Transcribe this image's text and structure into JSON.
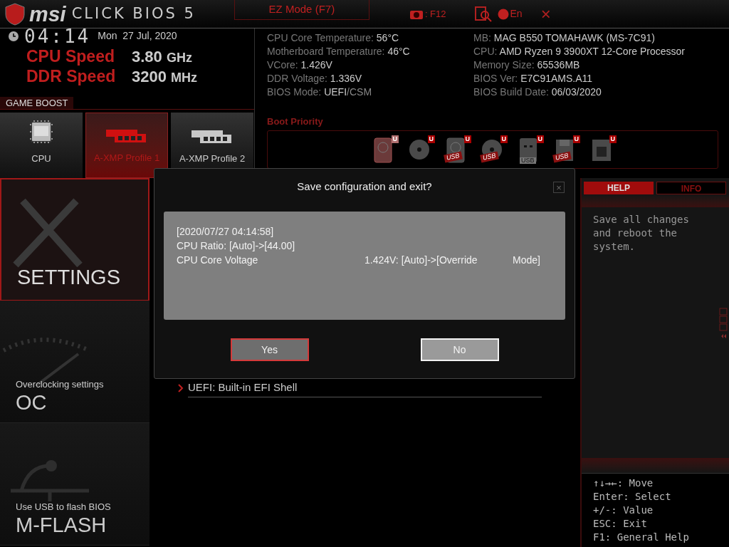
{
  "header": {
    "brand": "msi",
    "product": "CLICK BIOS 5",
    "ez_mode": "EZ Mode (F7)",
    "screenshot_key": ": F12",
    "language": "En",
    "close": "×"
  },
  "clock": {
    "time": "04:14",
    "date": "Mon  27 Jul, 2020"
  },
  "speeds": [
    {
      "label": "CPU Speed",
      "value": "3.80",
      "unit": "GHz"
    },
    {
      "label": "DDR Speed",
      "value": "3200",
      "unit": "MHz"
    }
  ],
  "game_boost": {
    "title": "GAME BOOST",
    "tiles": [
      {
        "kind": "cpu",
        "label": "CPU",
        "selected": false
      },
      {
        "kind": "ram",
        "label": "A-XMP Profile 1",
        "selected": true
      },
      {
        "kind": "ram2",
        "label": "A-XMP Profile 2",
        "selected": false
      }
    ]
  },
  "system_info": {
    "left": [
      {
        "label": "CPU Core Temperature:",
        "value": "56°C"
      },
      {
        "label": "Motherboard Temperature:",
        "value": "46°C"
      },
      {
        "label": "VCore:",
        "value": "1.426V"
      },
      {
        "label": "DDR Voltage:",
        "value": "1.336V"
      },
      {
        "label": "BIOS Mode:",
        "value": "UEFI",
        "value_2": "/CSM"
      }
    ],
    "right": [
      {
        "label": "MB:",
        "value": "MAG B550 TOMAHAWK (MS-7C91)"
      },
      {
        "label": "CPU:",
        "value": "AMD Ryzen 9 3900XT 12-Core Processor"
      },
      {
        "label": "Memory Size:",
        "value": "65536MB"
      },
      {
        "label": "BIOS Ver:",
        "value": "E7C91AMS.A11"
      },
      {
        "label": "BIOS Build Date:",
        "value": "06/03/2020"
      }
    ]
  },
  "boot_priority": {
    "title": "Boot Priority",
    "devices": [
      {
        "kind": "hdd",
        "badge": "U",
        "selected": true
      },
      {
        "kind": "optical",
        "badge": "U",
        "selected": false
      },
      {
        "kind": "usb-hdd",
        "badge": "U",
        "usb_label": "USB",
        "selected": false
      },
      {
        "kind": "usb-optical",
        "badge": "U",
        "usb_label": "USB",
        "selected": false
      },
      {
        "kind": "usb-key",
        "badge": "U",
        "usb_label": "USB",
        "selected": false
      },
      {
        "kind": "usb-floppy",
        "badge": "U",
        "usb_label": "USB",
        "selected": false
      },
      {
        "kind": "network",
        "badge": "U",
        "selected": false
      }
    ]
  },
  "nav": [
    {
      "kind": "settings",
      "title": "SETTINGS",
      "selected": true
    },
    {
      "kind": "oc",
      "subtitle": "Overclocking settings",
      "title": "OC",
      "selected": false
    },
    {
      "kind": "mflash",
      "subtitle": "Use USB to flash BIOS",
      "title": "M-FLASH",
      "selected": false
    }
  ],
  "menu_items": [
    {
      "label": "UEFI: Built-in EFI Shell"
    }
  ],
  "dialog": {
    "title": "Save configuration and exit?",
    "close": "×",
    "log": [
      {
        "text": "[2020/07/27 04:14:58]"
      },
      {
        "text": "CPU Ratio: [Auto]->[44.00]"
      },
      {
        "text": "CPU Core Voltage",
        "value": "1.424V: [Auto]->[Override",
        "value_end": "Mode]"
      }
    ],
    "buttons": [
      {
        "label": "Yes",
        "selected": true
      },
      {
        "label": "No",
        "selected": false
      }
    ]
  },
  "help_panel": {
    "tabs": [
      {
        "label": "HELP",
        "selected": true
      },
      {
        "label": "INFO",
        "selected": false
      }
    ],
    "text": "Save all changes and reboot the system.",
    "keys": [
      "↑↓→←: Move",
      "Enter: Select",
      "+/-: Value",
      "ESC: Exit",
      "F1: General Help"
    ]
  }
}
